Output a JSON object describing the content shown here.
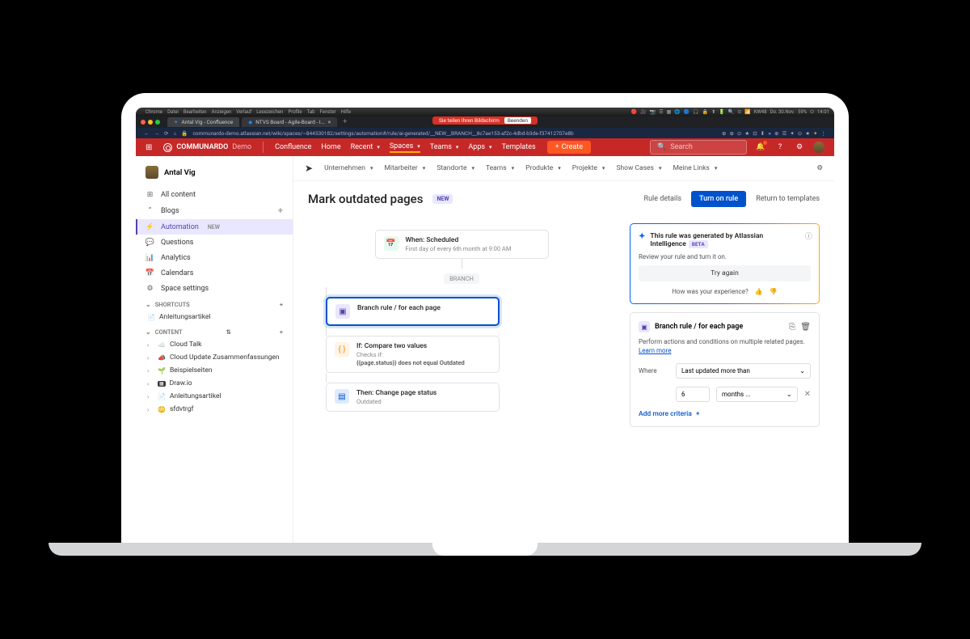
{
  "menubar": {
    "items": [
      "Chrome",
      "Datei",
      "Bearbeiten",
      "Anzeigen",
      "Verlauf",
      "Lesezeichen",
      "Profile",
      "Tab",
      "Fenster",
      "Hilfe"
    ],
    "week": "KW48",
    "date": "Do. 30.Nov.",
    "battery": "59%",
    "time": "14:01"
  },
  "tabs": {
    "tab1": "Antal Vig - Confluence",
    "tab2": "NTVS Board - Agile-Board - I..."
  },
  "url": "communardo-demo.atlassian.net/wiki/spaces/~844530182/settings/automation#/rule/ai-generated/__NEW__BRANCH__8c7ae153-af2c-4dbd-b3de-f37412707e8b",
  "share_banner": {
    "text": "Sie teilen Ihren Bildschirm",
    "stop": "Beenden"
  },
  "header": {
    "apps_icon": "⋮⋮⋮",
    "brand": "COMMUNARDO",
    "brand_suffix": "Demo",
    "nav": [
      {
        "l": "Confluence"
      },
      {
        "l": "Home"
      },
      {
        "l": "Recent",
        "c": true
      },
      {
        "l": "Spaces",
        "c": true,
        "active": true
      },
      {
        "l": "Teams",
        "c": true
      },
      {
        "l": "Apps",
        "c": true
      },
      {
        "l": "Templates"
      }
    ],
    "create": "Create",
    "search": "Search"
  },
  "sidebar": {
    "user": "Antal Vig",
    "items": [
      {
        "icon": "⊞",
        "l": "All content"
      },
      {
        "icon": "☰",
        "l": "Blogs",
        "plus": true
      },
      {
        "icon": "⚡",
        "l": "Automation",
        "tag": "NEW",
        "active": true
      },
      {
        "icon": "💬",
        "l": "Questions"
      },
      {
        "icon": "📊",
        "l": "Analytics"
      },
      {
        "icon": "📅",
        "l": "Calendars"
      },
      {
        "icon": "⚙",
        "l": "Space settings"
      }
    ],
    "shortcuts_label": "SHORTCUTS",
    "shortcuts": [
      {
        "icon": "📄",
        "l": "Anleitungsartikel"
      }
    ],
    "content_label": "CONTENT",
    "content": [
      {
        "icon": "☁️",
        "l": "Cloud Talk"
      },
      {
        "icon": "📣",
        "l": "Cloud Update Zusammenfassungen"
      },
      {
        "icon": "🌱",
        "l": "Beispielseiten"
      },
      {
        "icon": "🔲",
        "l": "Draw.io"
      },
      {
        "icon": "📄",
        "l": "Anleitungsartikel"
      },
      {
        "icon": "😳",
        "l": "sfdvtrgf"
      }
    ]
  },
  "breadcrumbs": [
    {
      "l": "Unternehmen",
      "c": true
    },
    {
      "l": "Mitarbeiter",
      "c": true
    },
    {
      "l": "Standorte",
      "c": true
    },
    {
      "l": "Teams",
      "c": true
    },
    {
      "l": "Produkte",
      "c": true
    },
    {
      "l": "Projekte",
      "c": true
    },
    {
      "l": "Show Cases",
      "c": true
    },
    {
      "l": "Meine Links",
      "c": true
    }
  ],
  "page": {
    "title": "Mark outdated pages",
    "new": "NEW",
    "rule_details": "Rule details",
    "turn_on": "Turn on rule",
    "return": "Return to templates"
  },
  "flow": {
    "when_title": "When: Scheduled",
    "when_sub": "First day of every 6th month at 9:00 AM",
    "branch_label": "BRANCH",
    "branch_title": "Branch rule / for each page",
    "if_title": "If: Compare two values",
    "if_sub1": "Checks if:",
    "if_sub2": "{{page.status}} does not equal Outdated",
    "then_title": "Then: Change page status",
    "then_sub": "Outdated"
  },
  "ai": {
    "title": "This rule was generated by Atlassian Intelligence",
    "beta": "BETA",
    "sub": "Review your rule and turn it on.",
    "btn": "Try again",
    "feedback": "How was your experience?"
  },
  "detail": {
    "title": "Branch rule / for each page",
    "desc": "Perform actions and conditions on multiple related pages.",
    "learn": "Learn more",
    "where": "Where",
    "select1": "Last updated more than",
    "num": "6",
    "select2": "months ...",
    "add": "Add more criteria"
  }
}
